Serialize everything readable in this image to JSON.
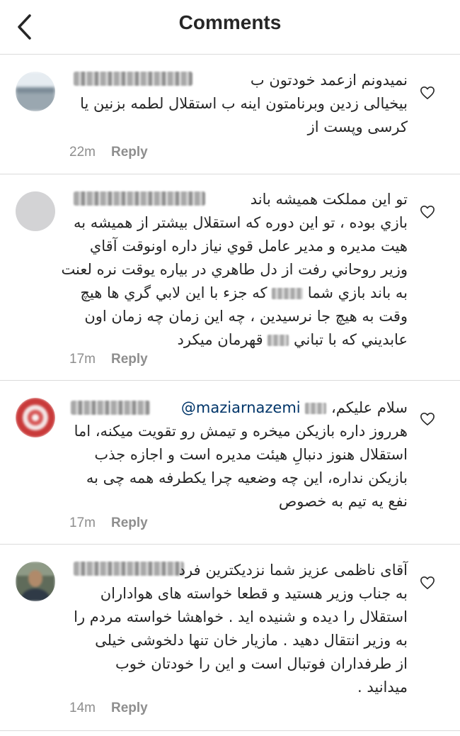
{
  "header": {
    "title": "Comments",
    "back_icon": "chevron-left-icon"
  },
  "comments": [
    {
      "username": "hassanimas7044",
      "lines": [
        "نمیدونم ازعمد خودتون ب",
        "بیخیالی زدین وبرنامتون اینه ب استقلال لطمه بزنین یا",
        "کرسی وپست از"
      ],
      "time": "22m",
      "reply": "Reply"
    },
    {
      "username": "hassanghasemi77",
      "lines": [
        "تو اين مملكت هميشه باند",
        "بازي بوده ، تو اين دوره كه استقلال بيشتر از هميشه به",
        "هيت مديره و مدير عامل قوي نياز داره اونوقت آقاي",
        "وزير روحاني رفت از دل طاهري در بياره يوقت نره لعنت",
        "به باند بازي شما {blur} كه جزء با اين لابي گري ها هيچ",
        "وقت به هيچ جا نرسيدين ، چه اين زمان چه زمان اون",
        "عابديني كه با تباني {blur} قهرمان ميكرد"
      ],
      "time": "17m",
      "reply": "Reply"
    },
    {
      "username": "mehdi_bader",
      "mention": "@maziarnazemi",
      "lines": [
        "سلام علیکم،",
        "هرروز داره بازیکن میخره و تیمش رو تقویت میکنه، اما",
        "استقلال هنوز دنبالِ هیئت مدیره است و اجازه جذب",
        "بازیکن نداره، این چه وضعیه چرا یکطرفه همه چی به",
        "نفع یه تیم به خصوص"
      ],
      "time": "17m",
      "reply": "Reply"
    },
    {
      "username": "jamal_a805",
      "lines": [
        "آقای ناظمی عزیز شما نزدیکترین فرد",
        "به جناب وزیر هستید و قطعا خواسته های هواداران",
        "استقلال را دیده و شنیده اید . خواهشا خواسته مردم را",
        "به وزیر انتقال دهید . مازیار خان تنها دلخوشی خیلی",
        "از طرفداران فوتبال است و این را خودتان خوب",
        "میدانید ."
      ],
      "time": "14m",
      "reply": "Reply"
    }
  ],
  "colors": {
    "text": "#262626",
    "meta": "#8e8e8e",
    "mention": "#003569",
    "divider": "#dbdbdb"
  }
}
